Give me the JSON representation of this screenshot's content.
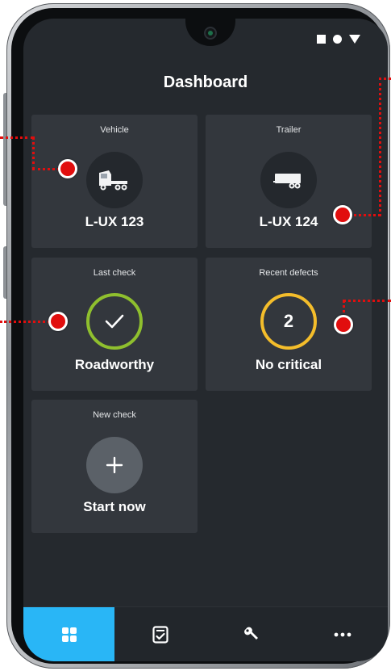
{
  "header": {
    "title": "Dashboard"
  },
  "status_icons": [
    "square-icon",
    "circle-icon",
    "triangle-icon"
  ],
  "cards": {
    "vehicle": {
      "label": "Vehicle",
      "value": "L-UX 123",
      "icon": "truck-icon"
    },
    "trailer": {
      "label": "Trailer",
      "value": "L-UX 124",
      "icon": "trailer-icon"
    },
    "last_check": {
      "label": "Last check",
      "value": "Roadworthy",
      "icon": "check-icon",
      "ring_color": "#8fbf2e"
    },
    "recent_defects": {
      "label": "Recent defects",
      "count": "2",
      "value": "No critical",
      "ring_color": "#f4bd2b"
    },
    "new_check": {
      "label": "New check",
      "value": "Start now",
      "icon": "plus-icon"
    }
  },
  "nav": {
    "active_color": "#29b6f6",
    "tabs": [
      {
        "icon": "dashboard-grid-icon",
        "active": true
      },
      {
        "icon": "checklist-icon",
        "active": false
      },
      {
        "icon": "wrench-icon",
        "active": false
      },
      {
        "icon": "more-icon",
        "active": false
      }
    ]
  },
  "callout_color": "#e10e0e"
}
